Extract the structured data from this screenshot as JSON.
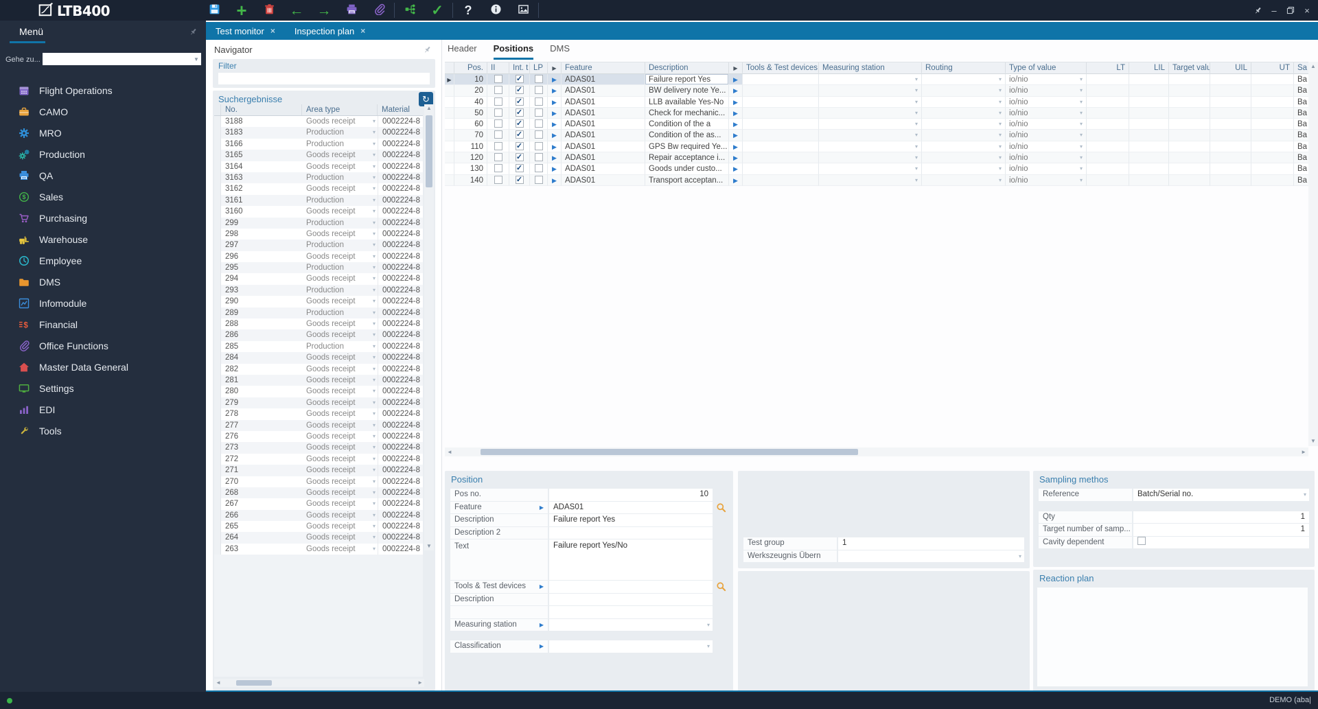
{
  "window": {
    "logo": "LTB400",
    "statusbar": {
      "user": "DEMO (aba|"
    }
  },
  "toolbar": {
    "buttons": [
      {
        "name": "save",
        "icon": "floppy",
        "color": "#2e9be6"
      },
      {
        "name": "add",
        "glyph": "+",
        "color": "#43b649",
        "size": 26
      },
      {
        "name": "delete",
        "icon": "trash",
        "color": "#d64541"
      },
      {
        "name": "back",
        "glyph": "←",
        "color": "#43b649",
        "size": 21
      },
      {
        "name": "forward",
        "glyph": "→",
        "color": "#43b649",
        "size": 21
      },
      {
        "name": "print",
        "icon": "printer",
        "color": "#7e63c6"
      },
      {
        "name": "attachment",
        "icon": "paperclip",
        "color": "#8a63c9"
      },
      {
        "divider": true
      },
      {
        "name": "share",
        "icon": "tree",
        "color": "#43b649"
      },
      {
        "name": "confirm",
        "glyph": "✓",
        "color": "#43b649",
        "size": 21
      },
      {
        "divider": true
      },
      {
        "name": "help",
        "glyph": "?",
        "color": "#e8edf2",
        "size": 18
      },
      {
        "name": "info",
        "icon": "info",
        "color": "#e8edf2"
      },
      {
        "name": "image",
        "icon": "image",
        "color": "#e8edf2"
      },
      {
        "divider": true
      }
    ],
    "window_controls": [
      {
        "name": "pin",
        "icon": "pin"
      },
      {
        "name": "minimize",
        "glyph": "–"
      },
      {
        "name": "restore",
        "icon": "restore"
      },
      {
        "name": "close",
        "glyph": "×"
      }
    ]
  },
  "sidebar": {
    "title": "Menü",
    "goto_label": "Gehe zu...",
    "goto_value": "",
    "items": [
      {
        "label": "Flight Operations",
        "icon": "calendar",
        "color": "#7e63c6"
      },
      {
        "label": "CAMO",
        "icon": "briefcase",
        "color": "#e8a33d"
      },
      {
        "label": "MRO",
        "icon": "gear",
        "color": "#2f8fd8"
      },
      {
        "label": "Production",
        "icon": "gears",
        "color": "#2ab5a5"
      },
      {
        "label": "QA",
        "icon": "printer2",
        "color": "#3b8edb"
      },
      {
        "label": "Sales",
        "icon": "dollar",
        "color": "#43b649"
      },
      {
        "label": "Purchasing",
        "icon": "cart",
        "color": "#9c5fc9"
      },
      {
        "label": "Warehouse",
        "icon": "forklift",
        "color": "#e8c73d"
      },
      {
        "label": "Employee",
        "icon": "clock",
        "color": "#2ab5c9"
      },
      {
        "label": "DMS",
        "icon": "folder",
        "color": "#e8962e"
      },
      {
        "label": "Infomodule",
        "icon": "linechart",
        "color": "#3b8edb"
      },
      {
        "label": "Financial",
        "icon": "finance",
        "color": "#e85c3d"
      },
      {
        "label": "Office Functions",
        "icon": "paperclip",
        "color": "#8a63c9"
      },
      {
        "label": "Master Data General",
        "icon": "home",
        "color": "#d94f4f"
      },
      {
        "label": "Settings",
        "icon": "monitor",
        "color": "#4fae3f"
      },
      {
        "label": "EDI",
        "icon": "barchart",
        "color": "#8a63c9"
      },
      {
        "label": "Tools",
        "icon": "wrench",
        "color": "#c9b23d"
      }
    ]
  },
  "doc_tabs": [
    {
      "label": "Test monitor"
    },
    {
      "label": "Inspection plan"
    }
  ],
  "navigator": {
    "title": "Navigator",
    "filter": {
      "title": "Filter",
      "value": ""
    },
    "results": {
      "title": "Suchergebnisse",
      "columns": [
        "No.",
        "Area type",
        "Material"
      ],
      "rows": [
        {
          "no": "3188",
          "area": "Goods receipt",
          "material": "0002224-8"
        },
        {
          "no": "3183",
          "area": "Production",
          "material": "0002224-8"
        },
        {
          "no": "3166",
          "area": "Production",
          "material": "0002224-8"
        },
        {
          "no": "3165",
          "area": "Goods receipt",
          "material": "0002224-8"
        },
        {
          "no": "3164",
          "area": "Goods receipt",
          "material": "0002224-8"
        },
        {
          "no": "3163",
          "area": "Production",
          "material": "0002224-8"
        },
        {
          "no": "3162",
          "area": "Goods receipt",
          "material": "0002224-8"
        },
        {
          "no": "3161",
          "area": "Production",
          "material": "0002224-8"
        },
        {
          "no": "3160",
          "area": "Goods receipt",
          "material": "0002224-8"
        },
        {
          "no": "299",
          "area": "Production",
          "material": "0002224-8"
        },
        {
          "no": "298",
          "area": "Goods receipt",
          "material": "0002224-8"
        },
        {
          "no": "297",
          "area": "Production",
          "material": "0002224-8"
        },
        {
          "no": "296",
          "area": "Goods receipt",
          "material": "0002224-8"
        },
        {
          "no": "295",
          "area": "Production",
          "material": "0002224-8"
        },
        {
          "no": "294",
          "area": "Goods receipt",
          "material": "0002224-8"
        },
        {
          "no": "293",
          "area": "Production",
          "material": "0002224-8"
        },
        {
          "no": "290",
          "area": "Goods receipt",
          "material": "0002224-8"
        },
        {
          "no": "289",
          "area": "Production",
          "material": "0002224-8"
        },
        {
          "no": "288",
          "area": "Goods receipt",
          "material": "0002224-8"
        },
        {
          "no": "286",
          "area": "Goods receipt",
          "material": "0002224-8"
        },
        {
          "no": "285",
          "area": "Production",
          "material": "0002224-8"
        },
        {
          "no": "284",
          "area": "Goods receipt",
          "material": "0002224-8"
        },
        {
          "no": "282",
          "area": "Goods receipt",
          "material": "0002224-8"
        },
        {
          "no": "281",
          "area": "Goods receipt",
          "material": "0002224-8"
        },
        {
          "no": "280",
          "area": "Goods receipt",
          "material": "0002224-8"
        },
        {
          "no": "279",
          "area": "Goods receipt",
          "material": "0002224-8"
        },
        {
          "no": "278",
          "area": "Goods receipt",
          "material": "0002224-8"
        },
        {
          "no": "277",
          "area": "Goods receipt",
          "material": "0002224-8"
        },
        {
          "no": "276",
          "area": "Goods receipt",
          "material": "0002224-8"
        },
        {
          "no": "273",
          "area": "Goods receipt",
          "material": "0002224-8"
        },
        {
          "no": "272",
          "area": "Goods receipt",
          "material": "0002224-8"
        },
        {
          "no": "271",
          "area": "Goods receipt",
          "material": "0002224-8"
        },
        {
          "no": "270",
          "area": "Goods receipt",
          "material": "0002224-8"
        },
        {
          "no": "268",
          "area": "Goods receipt",
          "material": "0002224-8"
        },
        {
          "no": "267",
          "area": "Goods receipt",
          "material": "0002224-8"
        },
        {
          "no": "266",
          "area": "Goods receipt",
          "material": "0002224-8"
        },
        {
          "no": "265",
          "area": "Goods receipt",
          "material": "0002224-8"
        },
        {
          "no": "264",
          "area": "Goods receipt",
          "material": "0002224-8"
        },
        {
          "no": "263",
          "area": "Goods receipt",
          "material": "0002224-8"
        }
      ]
    }
  },
  "main": {
    "tabs": [
      "Header",
      "Positions",
      "DMS"
    ],
    "active_tab": "Positions",
    "grid": {
      "columns": [
        {
          "label": ""
        },
        {
          "label": "Pos.",
          "align": "right"
        },
        {
          "label": "II"
        },
        {
          "label": "Int. t"
        },
        {
          "label": "LP"
        },
        {
          "label": "",
          "icon": "arrow"
        },
        {
          "label": "Feature"
        },
        {
          "label": "Description"
        },
        {
          "label": "",
          "icon": "arrow"
        },
        {
          "label": "Tools & Test devices"
        },
        {
          "label": "Measuring station"
        },
        {
          "label": "Routing"
        },
        {
          "label": "Type of value"
        },
        {
          "label": "LT",
          "align": "right"
        },
        {
          "label": "LIL",
          "align": "right"
        },
        {
          "label": "Target valu",
          "align": "right"
        },
        {
          "label": "UIL",
          "align": "right"
        },
        {
          "label": "UT",
          "align": "right"
        },
        {
          "label": "Sa"
        }
      ],
      "rows": [
        {
          "pos": "10",
          "ii": false,
          "int_checked": true,
          "lp": false,
          "feature": "ADAS01",
          "description": "Failure report Yes",
          "type_of_value": "io/nio",
          "sample": "Ba",
          "selected": true
        },
        {
          "pos": "20",
          "ii": false,
          "int_checked": true,
          "lp": false,
          "feature": "ADAS01",
          "description": "BW delivery note Ye...",
          "type_of_value": "io/nio",
          "sample": "Ba"
        },
        {
          "pos": "40",
          "ii": false,
          "int_checked": true,
          "lp": false,
          "feature": "ADAS01",
          "description": "LLB available Yes-No",
          "type_of_value": "io/nio",
          "sample": "Ba"
        },
        {
          "pos": "50",
          "ii": false,
          "int_checked": true,
          "lp": false,
          "feature": "ADAS01",
          "description": "Check for mechanic...",
          "type_of_value": "io/nio",
          "sample": "Ba"
        },
        {
          "pos": "60",
          "ii": false,
          "int_checked": true,
          "lp": false,
          "feature": "ADAS01",
          "description": "Condition of the a",
          "type_of_value": "io/nio",
          "sample": "Ba"
        },
        {
          "pos": "70",
          "ii": false,
          "int_checked": true,
          "lp": false,
          "feature": "ADAS01",
          "description": "Condition of the as...",
          "type_of_value": "io/nio",
          "sample": "Ba"
        },
        {
          "pos": "110",
          "ii": false,
          "int_checked": true,
          "lp": false,
          "feature": "ADAS01",
          "description": "GPS Bw required Ye...",
          "type_of_value": "io/nio",
          "sample": "Ba"
        },
        {
          "pos": "120",
          "ii": false,
          "int_checked": true,
          "lp": false,
          "feature": "ADAS01",
          "description": "Repair acceptance i...",
          "type_of_value": "io/nio",
          "sample": "Ba"
        },
        {
          "pos": "130",
          "ii": false,
          "int_checked": true,
          "lp": false,
          "feature": "ADAS01",
          "description": "Goods under custo...",
          "type_of_value": "io/nio",
          "sample": "Ba"
        },
        {
          "pos": "140",
          "ii": false,
          "int_checked": true,
          "lp": false,
          "feature": "ADAS01",
          "description": "Transport acceptan...",
          "type_of_value": "io/nio",
          "sample": "Ba"
        }
      ]
    }
  },
  "panels": {
    "position": {
      "title": "Position",
      "fields": [
        {
          "label": "Pos no.",
          "value": "10",
          "align": "right"
        },
        {
          "label": "Feature",
          "value": "ADAS01",
          "link_arrow": true,
          "search": true
        },
        {
          "label": "Description",
          "value": "Failure report Yes"
        },
        {
          "label": "Description 2",
          "value": ""
        },
        {
          "label": "Text",
          "value": "Failure report Yes/No",
          "multiline": true
        },
        {
          "label": "Tools & Test devices",
          "value": "",
          "link_arrow": true,
          "search": true
        },
        {
          "label": "Description",
          "value": ""
        },
        {
          "label": "",
          "value": ""
        },
        {
          "label": "Measuring station",
          "value": "",
          "link_arrow": true,
          "dropdown": true
        },
        {
          "label": "Classification",
          "value": "",
          "link_arrow": true,
          "dropdown": true,
          "gap_before": true
        }
      ]
    },
    "test_group": {
      "rows": [
        {
          "label": "Test group",
          "value": "1"
        },
        {
          "label": "Werkszeugnis Übern",
          "value": "",
          "dropdown": true
        }
      ]
    },
    "sampling": {
      "title": "Sampling methos",
      "rows": [
        {
          "label": "Reference",
          "value": "Batch/Serial no.",
          "dropdown": true
        },
        {
          "spacer": true
        },
        {
          "label": "Qty",
          "value": "1",
          "align": "right"
        },
        {
          "label": "Target number of samp...",
          "value": "1",
          "align": "right"
        },
        {
          "label": "Cavity dependent",
          "value": "",
          "checkbox": true,
          "checked": false
        }
      ]
    },
    "reaction": {
      "title": "Reaction plan",
      "value": ""
    }
  }
}
